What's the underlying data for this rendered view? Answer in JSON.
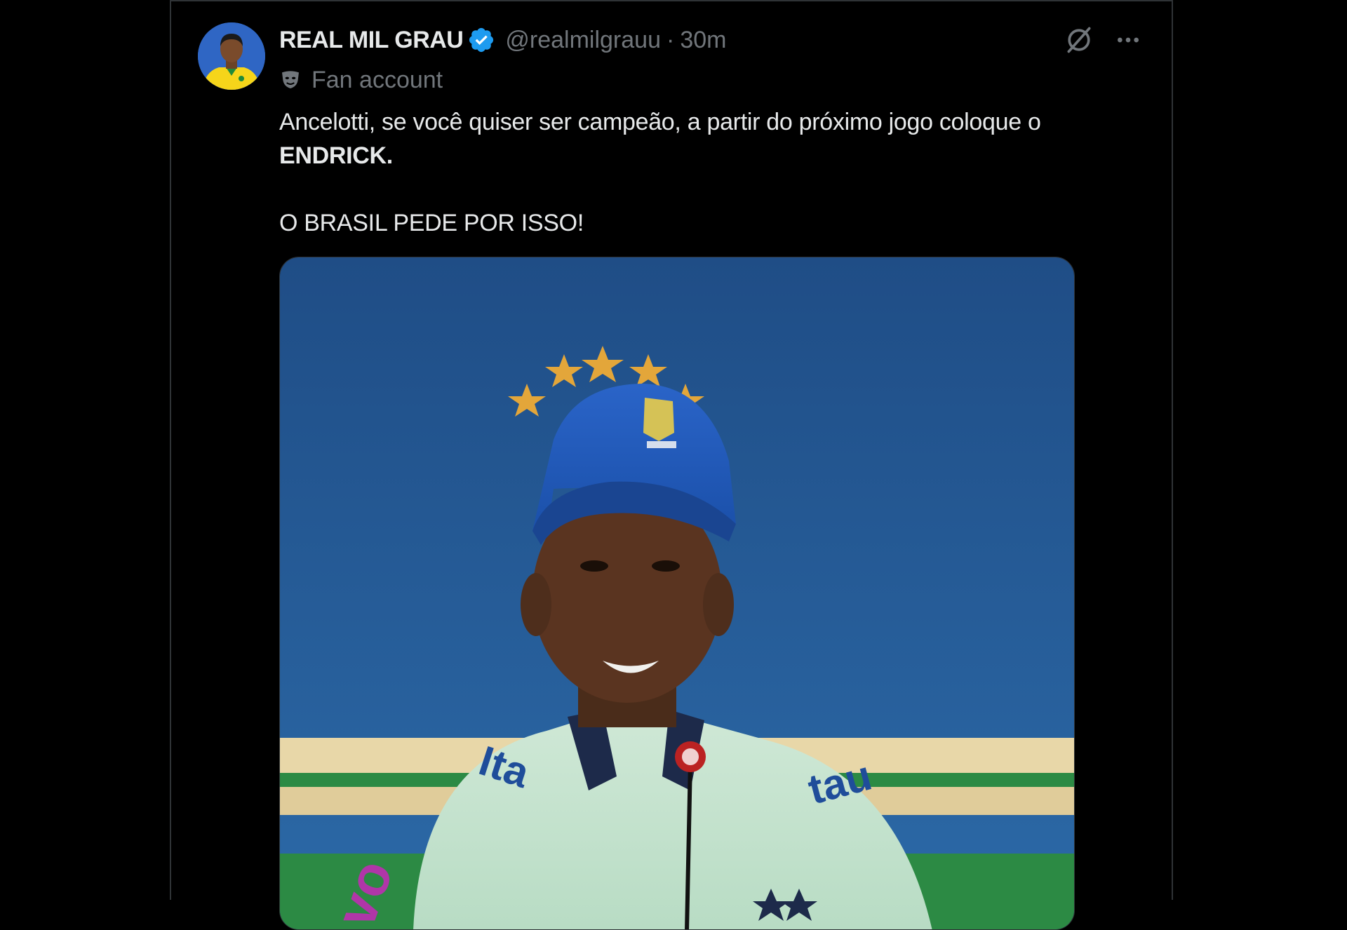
{
  "tweet": {
    "display_name": "REAL MIL GRAU",
    "handle": "@realmilgrauu",
    "separator": "·",
    "timestamp": "30m",
    "affiliation": "Fan account",
    "text_line1": "Ancelotti, se você quiser ser campeão,  a partir do próximo jogo coloque o",
    "text_line2": "ENDRICK.",
    "text_line3": "O BRASIL PEDE POR ISSO!"
  },
  "icons": {
    "verified": "verified-badge-icon",
    "grok": "grok-icon",
    "more": "more-icon",
    "affiliation": "mask-icon"
  },
  "colors": {
    "background": "#000000",
    "text": "#e7e9ea",
    "secondary": "#71767b",
    "verified_blue": "#1d9bf0",
    "border": "#2f3336"
  }
}
